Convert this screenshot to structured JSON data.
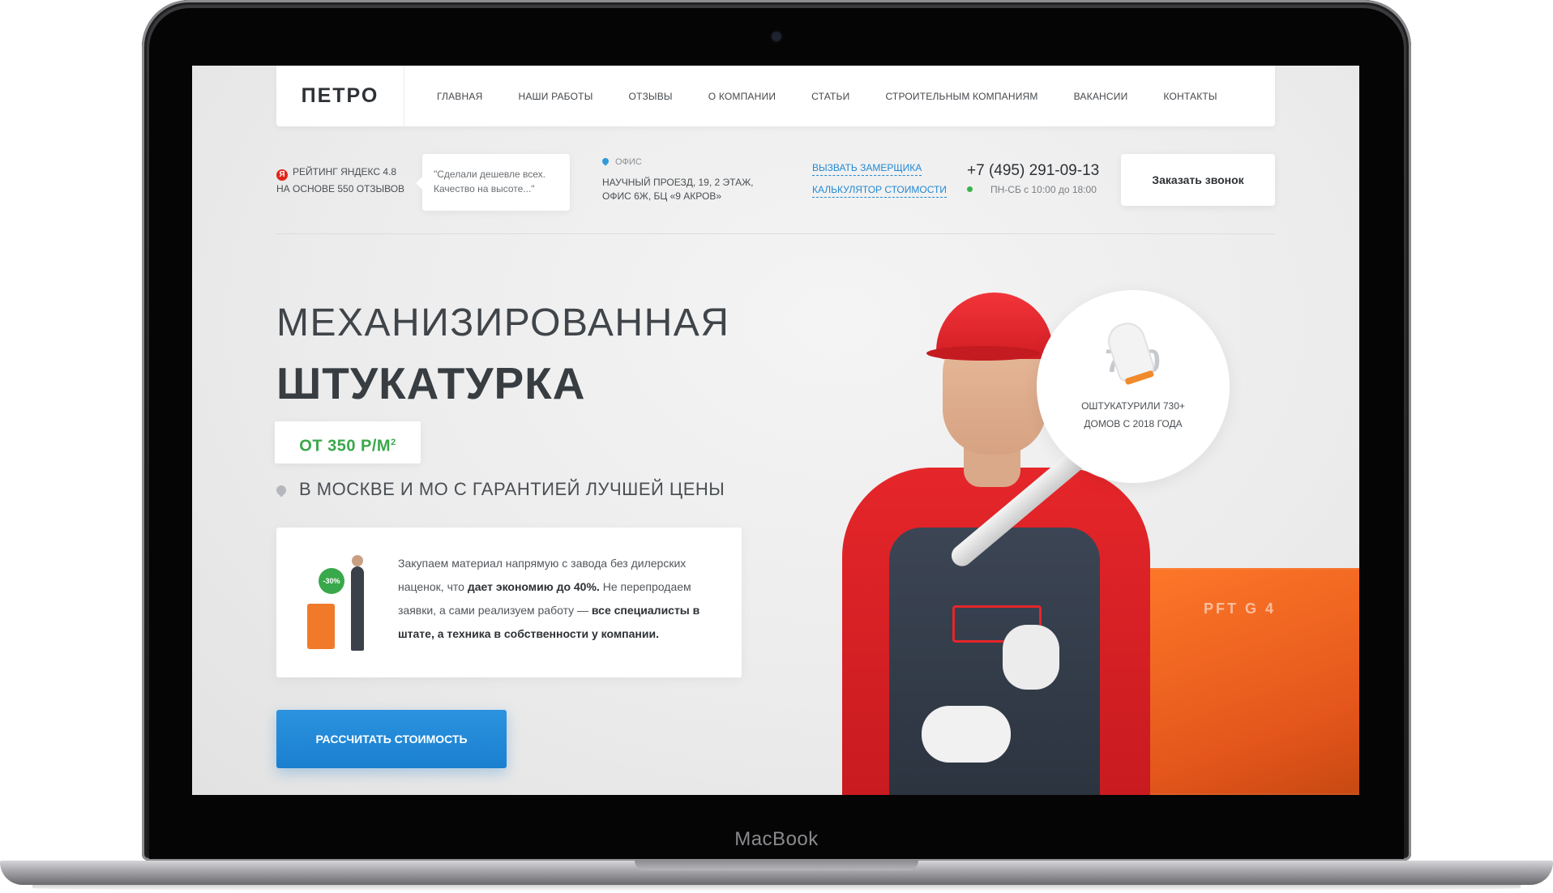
{
  "device": {
    "brand": "MacBook"
  },
  "site": {
    "logo": "ПЕТРО",
    "nav": [
      "ГЛАВНАЯ",
      "НАШИ РАБОТЫ",
      "ОТЗЫВЫ",
      "О КОМПАНИИ",
      "СТАТЬИ",
      "СТРОИТЕЛЬНЫМ КОМПАНИЯМ",
      "ВАКАНСИИ",
      "КОНТАКТЫ"
    ],
    "rating": {
      "line1": "РЕЙТИНГ ЯНДЕКС 4.8",
      "line2": "НА ОСНОВЕ 550 ОТЗЫВОВ",
      "icon": "yandex-icon"
    },
    "quote": "\"Сделали дешевле всех. Качество на высоте...\"",
    "office": {
      "label": "ОФИС",
      "line1": "НАУЧНЫЙ ПРОЕЗД, 19, 2 ЭТАЖ,",
      "line2": "ОФИС 6Ж, БЦ «9 АКРОВ»"
    },
    "links": {
      "measure": "ВЫЗВАТЬ ЗАМЕРЩИКА",
      "calculator": "КАЛЬКУЛЯТОР СТОИМОСТИ"
    },
    "phone": {
      "number": "+7 (495) 291-09-13",
      "hours": "ПН-СБ с 10:00 до 18:00"
    },
    "callback_button": "Заказать звонок",
    "hero": {
      "title_line1": "МЕХАНИЗИРОВАННАЯ",
      "title_line2": "ШТУКАТУРКА",
      "price": "ОТ 350 Р/М",
      "price_sup": "2",
      "geo": "В МОСКВЕ И МО С ГАРАНТИЕЙ ЛУЧШЕЙ ЦЕНЫ",
      "card": {
        "badge": "-30%",
        "text_part1": "Закупаем материал напрямую с завода без дилерских наценок, что ",
        "text_bold1": "дает экономию до 40%.",
        "text_part2": " Не перепродаем заявки, а сами реализуем работу — ",
        "text_bold2": "все специалисты в штате, а техника в собственности у компании."
      },
      "cta_button": "РАССЧИТАТЬ СТОИМОСТЬ",
      "machine_label": "PFT G 4",
      "stat": {
        "number": "730",
        "line1": "ОШТУКАТУРИЛИ 730+",
        "line2": "ДОМОВ С 2018 ГОДА"
      }
    },
    "colors": {
      "accent_blue": "#1a7fcf",
      "accent_green": "#39a84a",
      "brand_red": "#e5262a",
      "machine_orange": "#f07a2a"
    }
  }
}
